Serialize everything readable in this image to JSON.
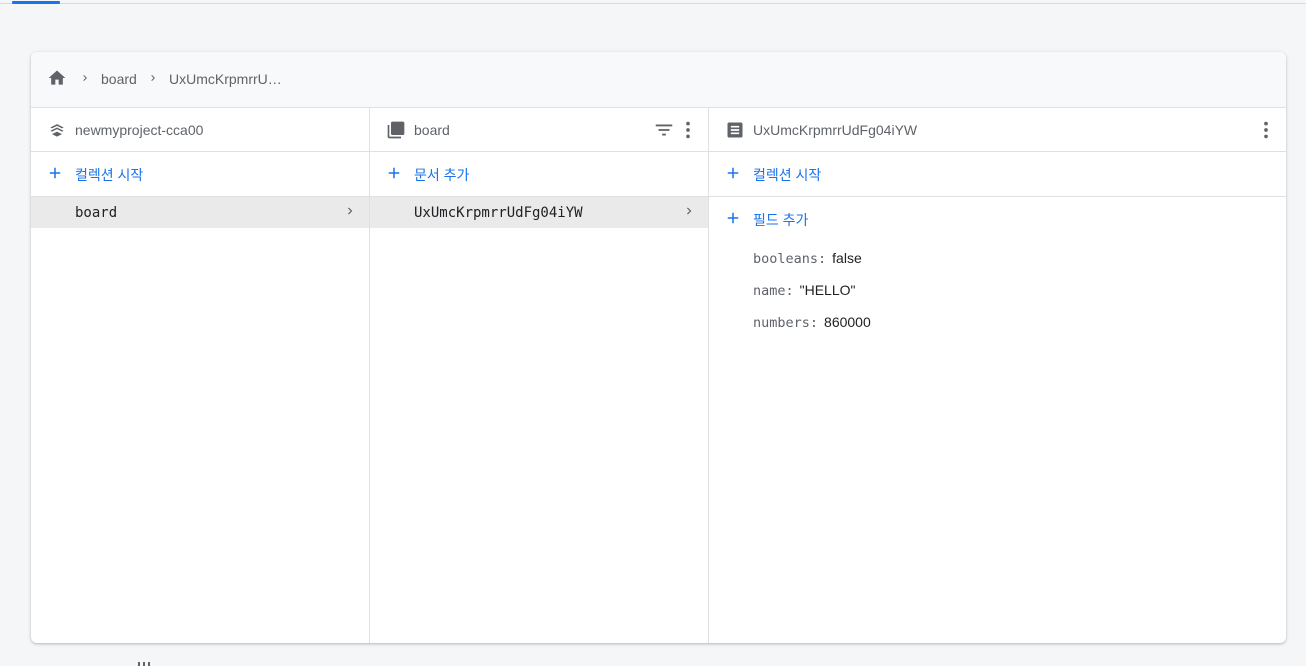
{
  "breadcrumb": {
    "home_icon": "home-icon",
    "items": [
      "board",
      "UxUmcKrpmrrU…"
    ]
  },
  "columns": {
    "project": {
      "title": "newmyproject-cca00",
      "icon": "firestore-icon",
      "add_label": "컬렉션 시작",
      "items": [
        {
          "label": "board",
          "selected": true
        }
      ]
    },
    "collection": {
      "title": "board",
      "icon": "collection-icon",
      "actions": [
        "filter-icon",
        "more-vert-icon"
      ],
      "add_label": "문서 추가",
      "items": [
        {
          "label": "UxUmcKrpmrrUdFg04iYW",
          "selected": true
        }
      ]
    },
    "document": {
      "title": "UxUmcKrpmrrUdFg04iYW",
      "icon": "document-icon",
      "actions": [
        "more-vert-icon"
      ],
      "add_collection_label": "컬렉션 시작",
      "add_field_label": "필드 추가",
      "fields": [
        {
          "key": "booleans:",
          "value": "false"
        },
        {
          "key": "name:",
          "value": "\"HELLO\""
        },
        {
          "key": "numbers:",
          "value": "860000"
        }
      ]
    }
  },
  "colors": {
    "accent": "#1a73e8",
    "selected_row": "#eaeaea",
    "background": "#f5f6f8"
  }
}
